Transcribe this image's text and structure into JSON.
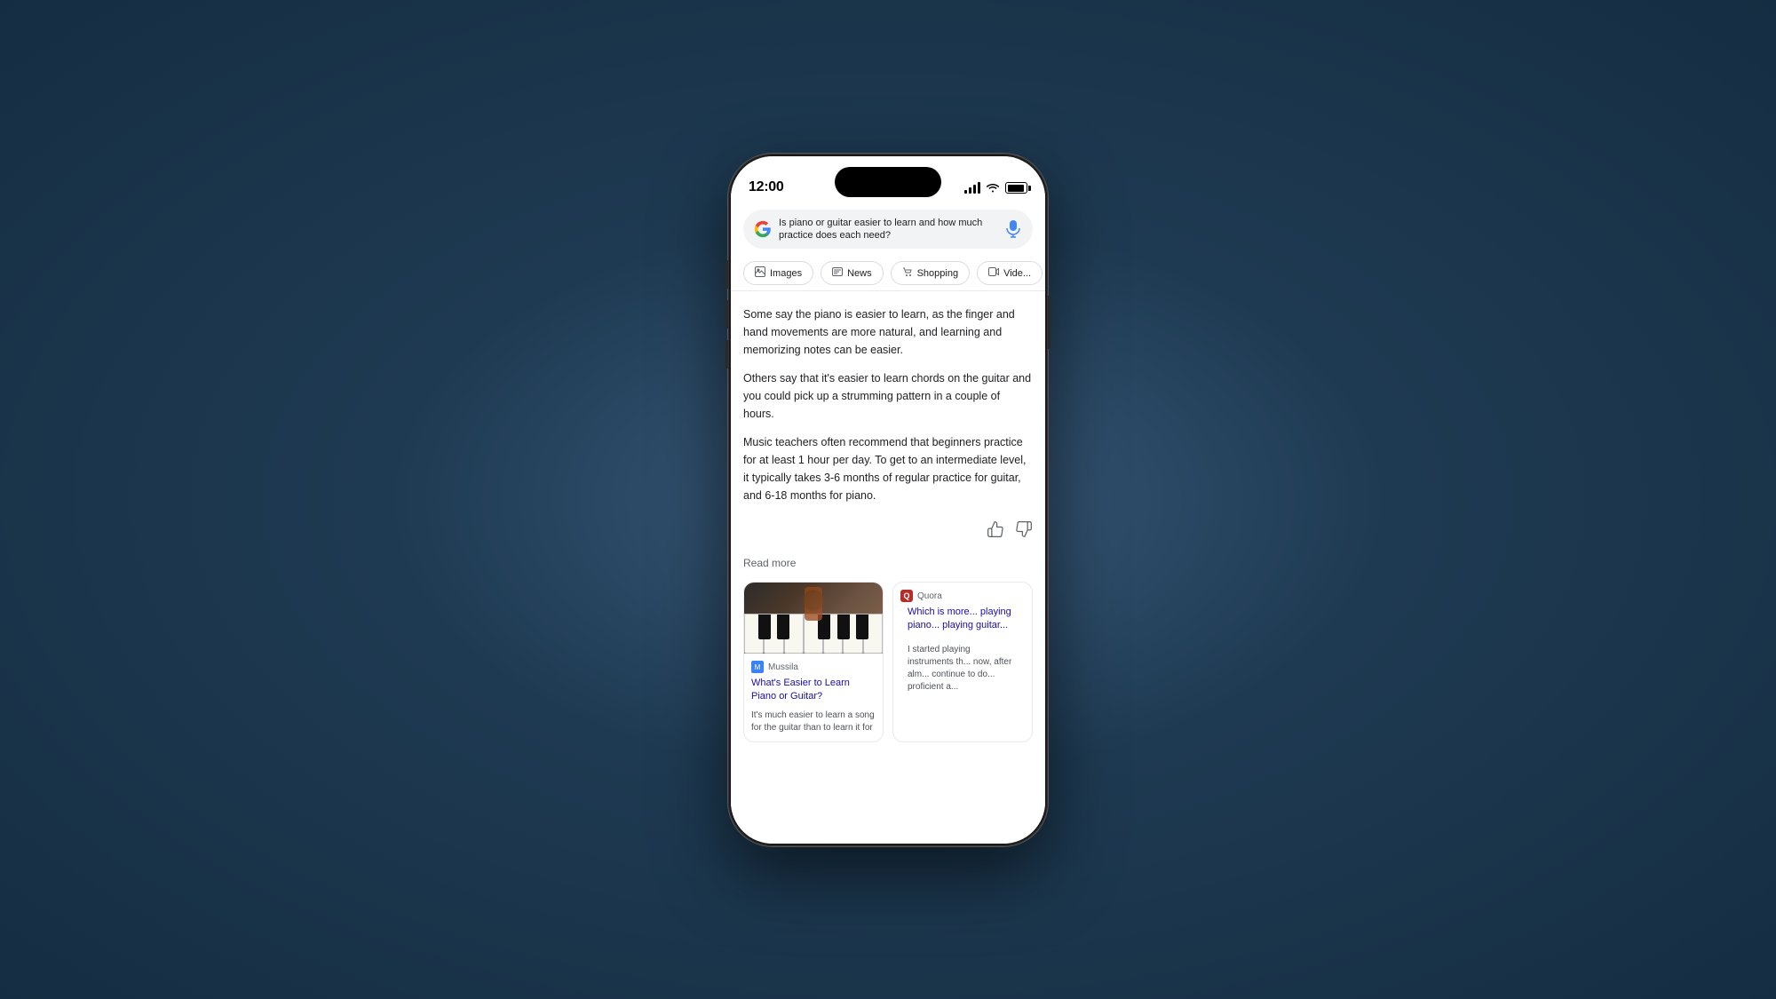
{
  "phone": {
    "status_bar": {
      "time": "12:00"
    },
    "search": {
      "query": "Is piano or guitar easier to learn and how much practice does each need?"
    },
    "filter_tabs": [
      {
        "label": "Images",
        "icon": "🖼"
      },
      {
        "label": "News",
        "icon": "📰"
      },
      {
        "label": "Shopping",
        "icon": "🛍"
      },
      {
        "label": "Vide...",
        "icon": "▶"
      }
    ],
    "ai_answer": {
      "paragraph1": "Some say the piano is easier to learn, as the finger and hand movements are more natural, and learning and memorizing notes can be easier.",
      "paragraph2": "Others say that it's easier to learn chords on the guitar and you could pick up a strumming pattern in a couple of hours.",
      "paragraph3": "Music teachers often recommend that beginners practice for at least 1 hour per day. To get to an intermediate level, it typically takes 3-6 months of regular practice for guitar, and 6-18 months for piano.",
      "read_more": "Read more"
    },
    "result_cards": [
      {
        "source": "Mussila",
        "title": "What's Easier to Learn Piano or Guitar?",
        "snippet": "It's much easier to learn a song for the guitar than to learn it for"
      },
      {
        "source": "Quora",
        "title": "Which is more... playing piano... playing guitar...",
        "snippet": "I started playing instruments th... now, after alm... continue to do... proficient a..."
      }
    ]
  }
}
